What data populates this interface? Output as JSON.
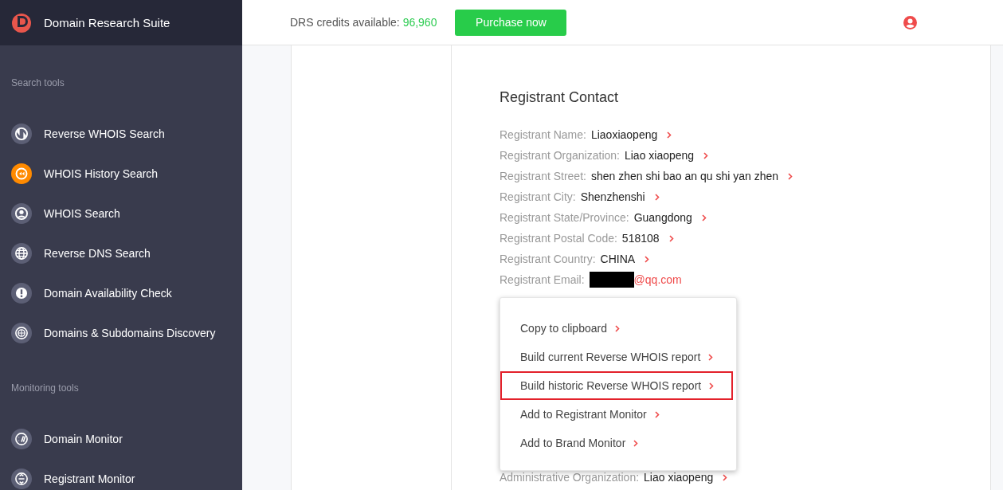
{
  "brand": {
    "title": "Domain Research Suite"
  },
  "sidebar": {
    "sections": [
      {
        "heading": "Search tools",
        "items": [
          {
            "label": "Reverse WHOIS Search",
            "selected": false
          },
          {
            "label": "WHOIS History Search",
            "selected": true
          },
          {
            "label": "WHOIS Search",
            "selected": false
          },
          {
            "label": "Reverse DNS Search",
            "selected": false
          },
          {
            "label": "Domain Availability Check",
            "selected": false
          },
          {
            "label": "Domains & Subdomains Discovery",
            "selected": false
          }
        ]
      },
      {
        "heading": "Monitoring tools",
        "items": [
          {
            "label": "Domain Monitor",
            "selected": false
          },
          {
            "label": "Registrant Monitor",
            "selected": false
          }
        ]
      }
    ]
  },
  "topbar": {
    "credits_label": "DRS credits available:",
    "credits_value": "96,960",
    "purchase_button": "Purchase now"
  },
  "contact": {
    "title": "Registrant Contact",
    "fields": [
      {
        "label": "Registrant Name:",
        "value": "Liaoxiaopeng",
        "redacted": false
      },
      {
        "label": "Registrant Organization:",
        "value": "Liao xiaopeng",
        "redacted": false
      },
      {
        "label": "Registrant Street:",
        "value": "shen zhen shi bao an qu shi yan zhen",
        "redacted": false
      },
      {
        "label": "Registrant City:",
        "value": "Shenzhenshi",
        "redacted": false
      },
      {
        "label": "Registrant State/Province:",
        "value": "Guangdong",
        "redacted": false
      },
      {
        "label": "Registrant Postal Code:",
        "value": "518108",
        "redacted": false
      },
      {
        "label": "Registrant Country:",
        "value": "CHINA",
        "redacted": false
      },
      {
        "label": "Registrant Email:",
        "value": "@qq.com",
        "redacted": true,
        "kind": "link"
      }
    ],
    "after_menu": [
      {
        "label": "Administrative Organization:",
        "value": "Liao xiaopeng",
        "redacted": false
      }
    ]
  },
  "context_menu": {
    "items": [
      {
        "label": "Copy to clipboard",
        "highlighted": false
      },
      {
        "label": "Build current Reverse WHOIS report",
        "highlighted": false
      },
      {
        "label": "Build historic Reverse WHOIS report",
        "highlighted": true
      },
      {
        "label": "Add to Registrant Monitor",
        "highlighted": false
      },
      {
        "label": "Add to Brand Monitor",
        "highlighted": false
      }
    ]
  }
}
